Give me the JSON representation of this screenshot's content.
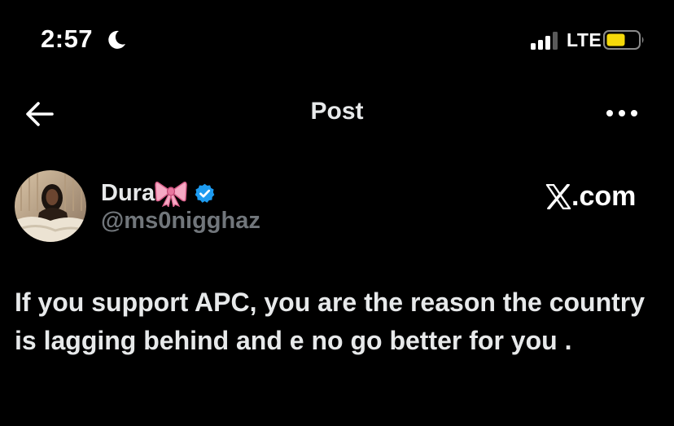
{
  "status_bar": {
    "time": "2:57",
    "network": "LTE",
    "icons": [
      "moon-icon",
      "signal-icon",
      "battery-icon"
    ],
    "battery_color": "#f5d90a"
  },
  "header": {
    "title": "Post",
    "back_icon": "arrow-left-icon",
    "more_icon": "ellipsis-icon"
  },
  "author": {
    "display_name": "Dura",
    "name_emoji": "bow-icon",
    "verified": true,
    "verified_color": "#1d9bf0",
    "handle": "@ms0nigghaz"
  },
  "brand": {
    "logo": "x-logo-icon",
    "text": ".com"
  },
  "post": {
    "text": "If you support APC, you are the reason the country is lagging behind and e no go better for you ."
  },
  "colors": {
    "background": "#000000",
    "text_primary": "#e7e9ea",
    "text_secondary": "#71767b"
  }
}
